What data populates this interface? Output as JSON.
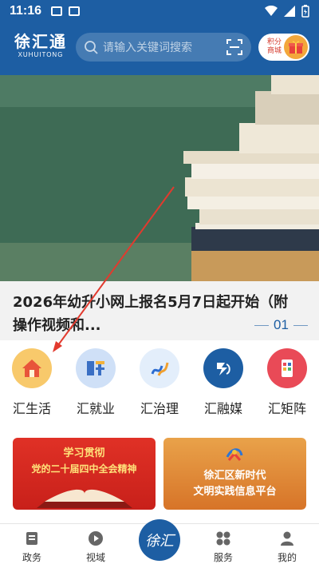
{
  "status_bar": {
    "time": "11:16"
  },
  "header": {
    "logo_text": "徐汇通",
    "logo_sub": "XUHUITONG",
    "search_placeholder": "请输入关键词搜索",
    "points_label": "积分商城"
  },
  "banner": {
    "title": "2026年幼升小网上报名5月7日起开始（附操作视频和...",
    "page_indicator": "01"
  },
  "quick_nav": [
    {
      "label": "汇生活",
      "icon": "house-icon",
      "color": "#f8c96b"
    },
    {
      "label": "汇就业",
      "icon": "recruit-icon",
      "color": "#cfe0f7"
    },
    {
      "label": "汇治理",
      "icon": "governance-icon",
      "color": "#e3eefb"
    },
    {
      "label": "汇融媒",
      "icon": "media-icon",
      "color": "#1d5ea3"
    },
    {
      "label": "汇矩阵",
      "icon": "matrix-icon",
      "color": "#e94a57"
    }
  ],
  "promos": [
    {
      "line1": "学习贯彻",
      "line2": "党的二十届四中全会精神"
    },
    {
      "line1": "徐汇区新时代",
      "line2": "文明实践信息平台"
    }
  ],
  "bottom_tabs": [
    {
      "label": "政务",
      "icon": "document-icon"
    },
    {
      "label": "视域",
      "icon": "play-icon"
    },
    {
      "label": "服务",
      "icon": "grid-icon"
    },
    {
      "label": "我的",
      "icon": "user-icon"
    }
  ],
  "center_tab_logo": "徐汇",
  "colors": {
    "brand": "#1d5ea3",
    "accent_red": "#d4382b"
  }
}
